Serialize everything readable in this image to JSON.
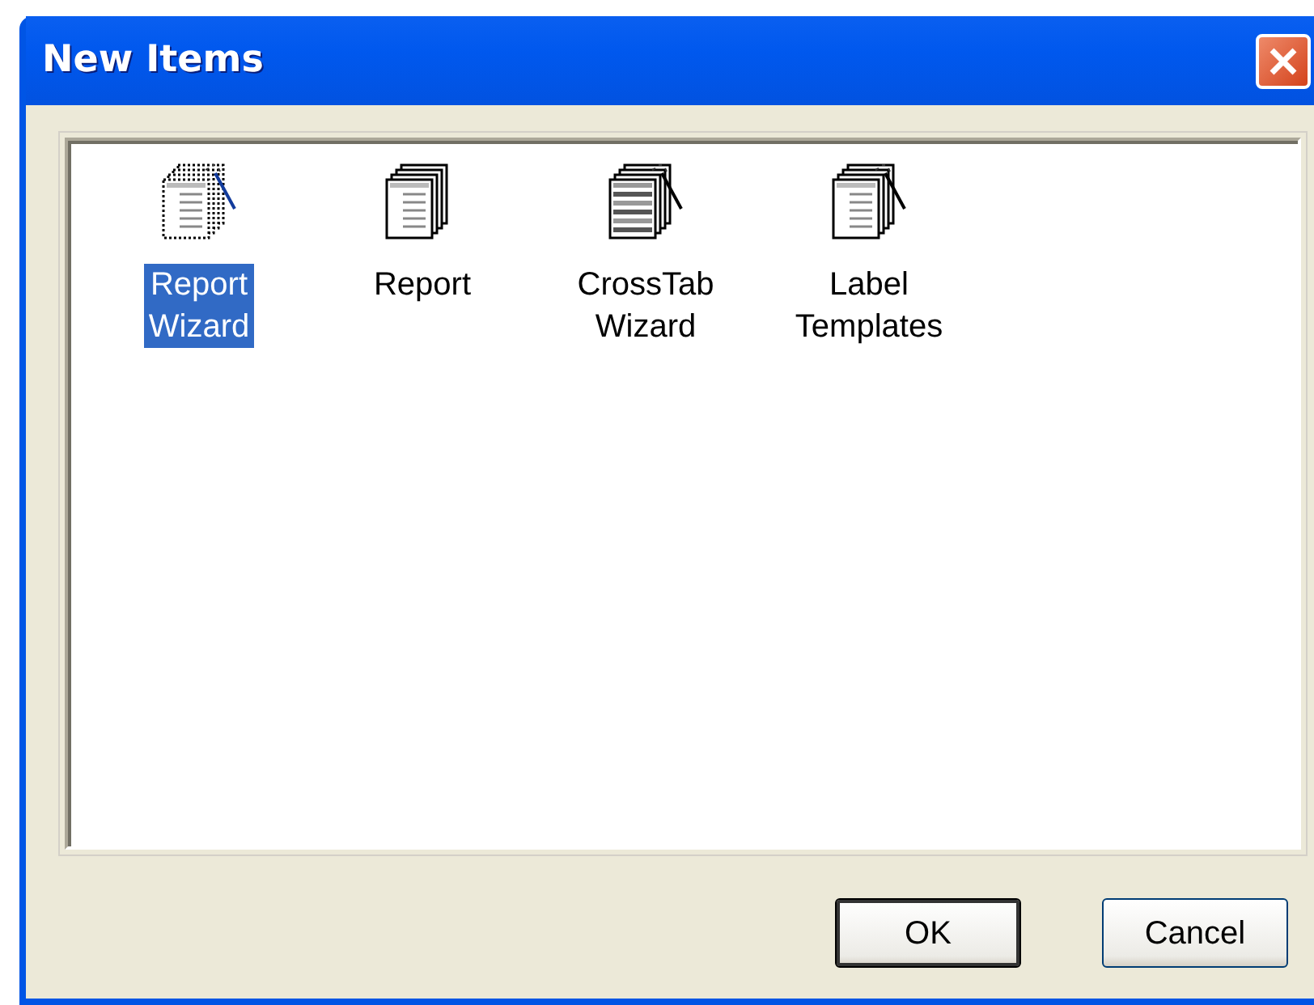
{
  "window": {
    "title": "New Items"
  },
  "items": [
    {
      "label": "Report\nWizard",
      "kind": "dotted-wand",
      "selected": true
    },
    {
      "label": "Report",
      "kind": "pages",
      "selected": false
    },
    {
      "label": "CrossTab\nWizard",
      "kind": "grid-wand",
      "selected": false
    },
    {
      "label": "Label\nTemplates",
      "kind": "pages-wand",
      "selected": false
    }
  ],
  "buttons": [
    {
      "label": "OK",
      "default": true
    },
    {
      "label": "Cancel",
      "default": false
    }
  ]
}
